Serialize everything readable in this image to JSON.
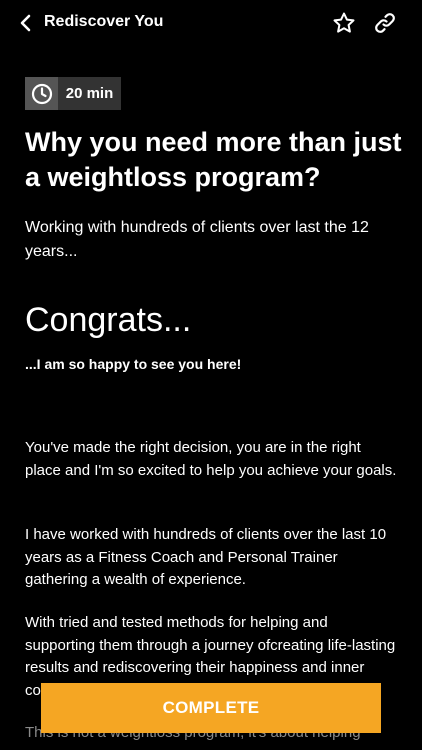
{
  "header": {
    "title": "Rediscover You",
    "back_icon": "chevron-left-icon",
    "favorite_icon": "star-outline-icon",
    "share_icon": "link-icon"
  },
  "duration": {
    "icon": "clock-icon",
    "label": "20 min"
  },
  "article": {
    "title": "Why you need more than just a weightloss program?",
    "subtitle": "Working with hundreds of clients over last the 12 years...",
    "heading": "Congrats...",
    "lead": "...I am so happy to see you here!",
    "paragraphs": [
      "You've made the right decision, you are in the right place and I'm so excited to help you achieve your goals.",
      "I have worked with hundreds of clients over the last 10 years as a Fitness Coach and Personal Trainer gathering a wealth of experience.",
      "With tried and tested methods for helping and supporting them through a journey ofcreating life-lasting results and rediscovering their happiness and inner confidence.",
      "This is not a weightloss program, it's about helping"
    ]
  },
  "complete_button": {
    "label": "COMPLETE"
  },
  "colors": {
    "background": "#000000",
    "accent": "#f5a623",
    "badge_background": "#333333",
    "badge_icon_background": "#555555",
    "text": "#ffffff"
  }
}
